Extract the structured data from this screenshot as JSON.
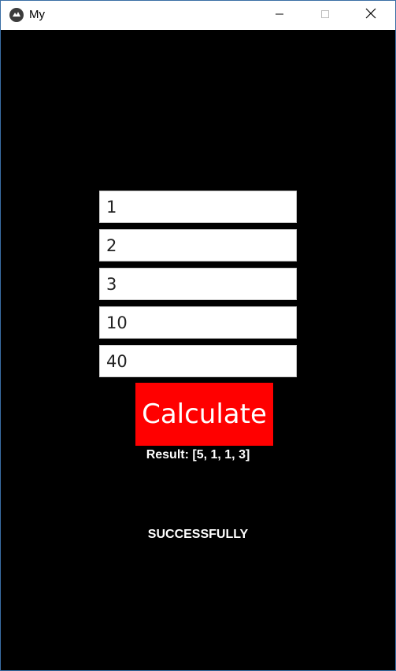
{
  "window": {
    "title": "My",
    "icons": {
      "app": "kivy-logo-icon",
      "minimize": "minimize-icon",
      "maximize": "maximize-icon",
      "close": "close-icon"
    }
  },
  "inputs": [
    {
      "value": "1"
    },
    {
      "value": "2"
    },
    {
      "value": "3"
    },
    {
      "value": "10"
    },
    {
      "value": "40"
    }
  ],
  "calculate_button": {
    "label": "Calculate",
    "background": "#ff0000"
  },
  "result_text": "Result: [5, 1, 1, 3]",
  "status_text": "SUCCESSFULLY"
}
